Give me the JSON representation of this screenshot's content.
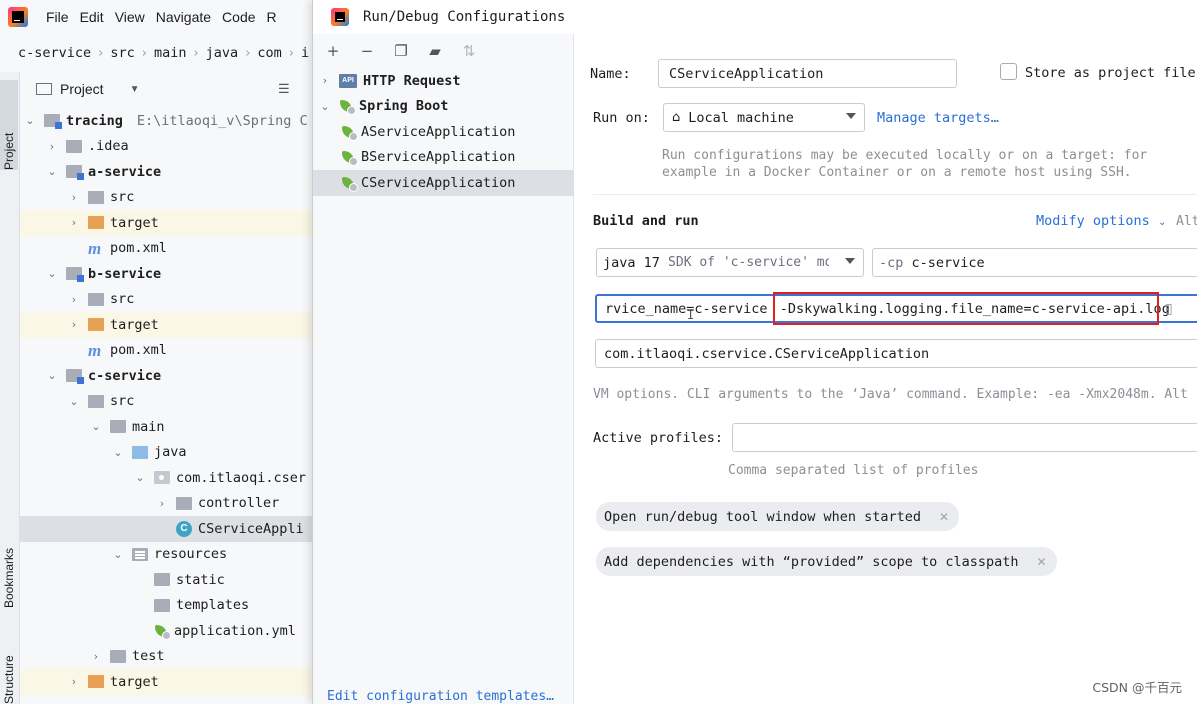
{
  "ide": {
    "menu": [
      "File",
      "Edit",
      "View",
      "Navigate",
      "Code",
      "R"
    ],
    "breadcrumb": [
      "c-service",
      "src",
      "main",
      "java",
      "com",
      "i"
    ],
    "side_tabs": {
      "project": "Project",
      "bookmarks": "Bookmarks",
      "structure": "Structure"
    },
    "project_panel": {
      "title": "Project",
      "tree": [
        {
          "label": "tracing",
          "extra": "E:\\itlaoqi_v\\Spring C",
          "icon": "module-icon",
          "bold": true,
          "depth": 0,
          "arrow": "down"
        },
        {
          "label": ".idea",
          "icon": "folder-icon",
          "depth": 1,
          "arrow": "right"
        },
        {
          "label": "a-service",
          "icon": "module-icon",
          "bold": true,
          "depth": 1,
          "arrow": "down"
        },
        {
          "label": "src",
          "icon": "folder-icon",
          "depth": 2,
          "arrow": "right"
        },
        {
          "label": "target",
          "icon": "orange-folder-icon",
          "depth": 2,
          "arrow": "right",
          "hl": true
        },
        {
          "label": "pom.xml",
          "icon": "maven-icon",
          "depth": 2,
          "arrow": ""
        },
        {
          "label": "b-service",
          "icon": "module-icon",
          "bold": true,
          "depth": 1,
          "arrow": "down"
        },
        {
          "label": "src",
          "icon": "folder-icon",
          "depth": 2,
          "arrow": "right"
        },
        {
          "label": "target",
          "icon": "orange-folder-icon",
          "depth": 2,
          "arrow": "right",
          "hl": true
        },
        {
          "label": "pom.xml",
          "icon": "maven-icon",
          "depth": 2,
          "arrow": ""
        },
        {
          "label": "c-service",
          "icon": "module-icon",
          "bold": true,
          "depth": 1,
          "arrow": "down"
        },
        {
          "label": "src",
          "icon": "folder-icon",
          "depth": 2,
          "arrow": "down"
        },
        {
          "label": "main",
          "icon": "folder-icon",
          "depth": 3,
          "arrow": "down"
        },
        {
          "label": "java",
          "icon": "blue-folder-icon",
          "depth": 4,
          "arrow": "down"
        },
        {
          "label": "com.itlaoqi.cser",
          "icon": "package-icon",
          "depth": 5,
          "arrow": "down"
        },
        {
          "label": "controller",
          "icon": "folder-icon",
          "depth": 6,
          "arrow": "right"
        },
        {
          "label": "CServiceAppli",
          "icon": "class-icon",
          "depth": 6,
          "arrow": "",
          "sel": true
        },
        {
          "label": "resources",
          "icon": "resources-folder-icon",
          "depth": 4,
          "arrow": "down"
        },
        {
          "label": "static",
          "icon": "folder-icon",
          "depth": 5,
          "arrow": ""
        },
        {
          "label": "templates",
          "icon": "folder-icon",
          "depth": 5,
          "arrow": ""
        },
        {
          "label": "application.yml",
          "icon": "spring-config-icon",
          "depth": 5,
          "arrow": ""
        },
        {
          "label": "test",
          "icon": "folder-icon",
          "depth": 3,
          "arrow": "right"
        },
        {
          "label": "target",
          "icon": "orange-folder-icon",
          "depth": 2,
          "arrow": "right",
          "hl": true
        }
      ]
    }
  },
  "dialog": {
    "title": "Run/Debug Configurations",
    "toolbar": [
      "add-icon",
      "remove-icon",
      "copy-icon",
      "new-folder-icon",
      "sort-icon"
    ],
    "config_tree": [
      {
        "label": "HTTP Request",
        "icon": "api-icon",
        "bold": true,
        "depth": 0,
        "arrow": "right"
      },
      {
        "label": "Spring Boot",
        "icon": "spring-boot-icon",
        "bold": true,
        "depth": 0,
        "arrow": "down"
      },
      {
        "label": "AServiceApplication",
        "icon": "spring-boot-icon",
        "depth": 1
      },
      {
        "label": "BServiceApplication",
        "icon": "spring-boot-icon",
        "depth": 1
      },
      {
        "label": "CServiceApplication",
        "icon": "spring-boot-icon",
        "depth": 1,
        "sel": true
      }
    ],
    "edit_templates_link": "Edit configuration templates…",
    "form": {
      "name_label": "Name:",
      "name_value": "CServiceApplication",
      "store_label": "Store as project file",
      "store_checked": false,
      "run_on_label": "Run on:",
      "run_on_value": "Local machine",
      "manage_targets": "Manage targets…",
      "run_on_hint_1": "Run configurations may be executed locally or on a target: for",
      "run_on_hint_2": "example in a Docker Container or on a remote host using SSH.",
      "build_run_label": "Build and run",
      "modify_options": "Modify options",
      "alt_hint": "Alt",
      "jdk_bold": "java 17",
      "jdk_hint": "SDK of 'c-service' mo",
      "cp_flag": "-cp",
      "cp_value": "c-service",
      "vm_options_prefix": "rvice_name=c-service ",
      "vm_options_highlight": "-Dskywalking.logging.file_name=c-service-api.log",
      "main_class": "com.itlaoqi.cservice.CServiceApplication",
      "vm_hint": "VM options. CLI arguments to the ‘Java’ command. Example: -ea -Xmx2048m. Alt",
      "active_profiles_label": "Active profiles:",
      "active_profiles_value": "",
      "profiles_hint": "Comma separated list of profiles",
      "chips": [
        "Open run/debug tool window when started",
        "Add dependencies with “provided” scope to classpath"
      ]
    }
  },
  "watermark": "CSDN @千百元",
  "colors": {
    "accent": "#2a6fd6",
    "highlight_box": "#e0201f",
    "selection": "#dcdfe4",
    "spring_green": "#6db33f"
  }
}
